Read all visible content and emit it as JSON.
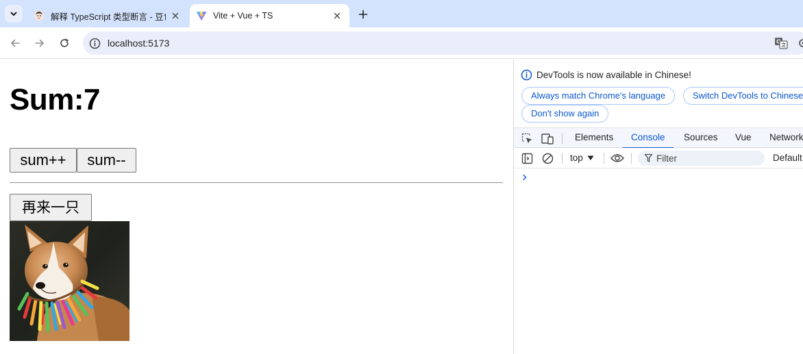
{
  "browser": {
    "tabs": [
      {
        "title": "解释 TypeScript 类型断言 - 豆包",
        "active": false,
        "favicon": "doubao-avatar-icon"
      },
      {
        "title": "Vite + Vue + TS",
        "active": true,
        "favicon": "vite-logo-icon"
      }
    ],
    "url": "localhost:5173",
    "colors": {
      "tabstrip": "#d3e3fd",
      "omnibox": "#e9eefa",
      "accent": "#0b57d0"
    }
  },
  "page": {
    "heading": "Sum:7",
    "buttons": {
      "increment": "sum++",
      "decrement": "sum--",
      "another_dog": "再来一只"
    },
    "image": {
      "subject": "corgi dog with colorful feather collar"
    }
  },
  "devtools": {
    "notice": "DevTools is now available in Chinese!",
    "notice_buttons": {
      "match": "Always match Chrome's language",
      "switch": "Switch DevTools to Chinese",
      "dont_show": "Don't show again"
    },
    "tabs": [
      "Elements",
      "Console",
      "Sources",
      "Vue",
      "Network"
    ],
    "active_tab": "Console",
    "console": {
      "context": "top",
      "filter_placeholder": "Filter",
      "levels": "Default levels"
    }
  }
}
